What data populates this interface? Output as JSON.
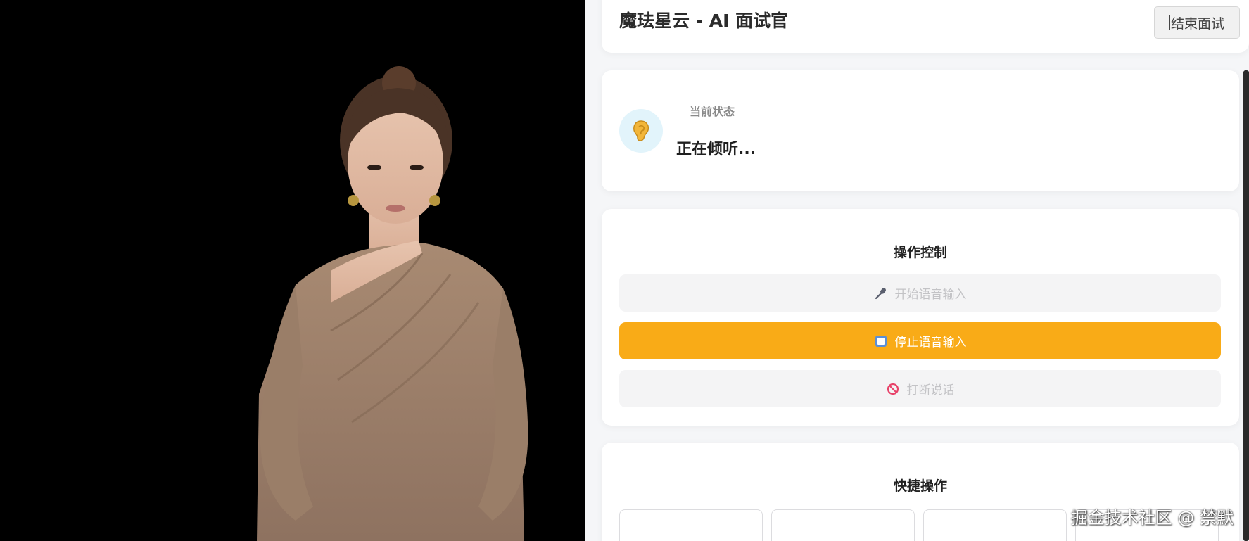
{
  "header": {
    "title": "魔珐星云 - AI 面试官",
    "end_button_label": "结束面试"
  },
  "status": {
    "label": "当前状态",
    "value": "正在倾听...",
    "icon": "ear-icon"
  },
  "controls": {
    "title": "操作控制",
    "buttons": [
      {
        "label": "开始语音输入",
        "icon": "microphone-icon",
        "state": "disabled"
      },
      {
        "label": "停止语音输入",
        "icon": "stop-square-icon",
        "state": "active"
      },
      {
        "label": "打断说话",
        "icon": "prohibited-icon",
        "state": "disabled"
      }
    ]
  },
  "quick_actions": {
    "title": "快捷操作",
    "tiles": [
      "",
      "",
      "",
      ""
    ]
  },
  "avatar": {
    "description_icon": "ai-avatar-video"
  },
  "watermark": "掘金技术社区 @ 禁默",
  "colors": {
    "accent": "#f9ab17",
    "avatar_background": "#000000",
    "status_icon_bg": "#e2f4fb"
  }
}
